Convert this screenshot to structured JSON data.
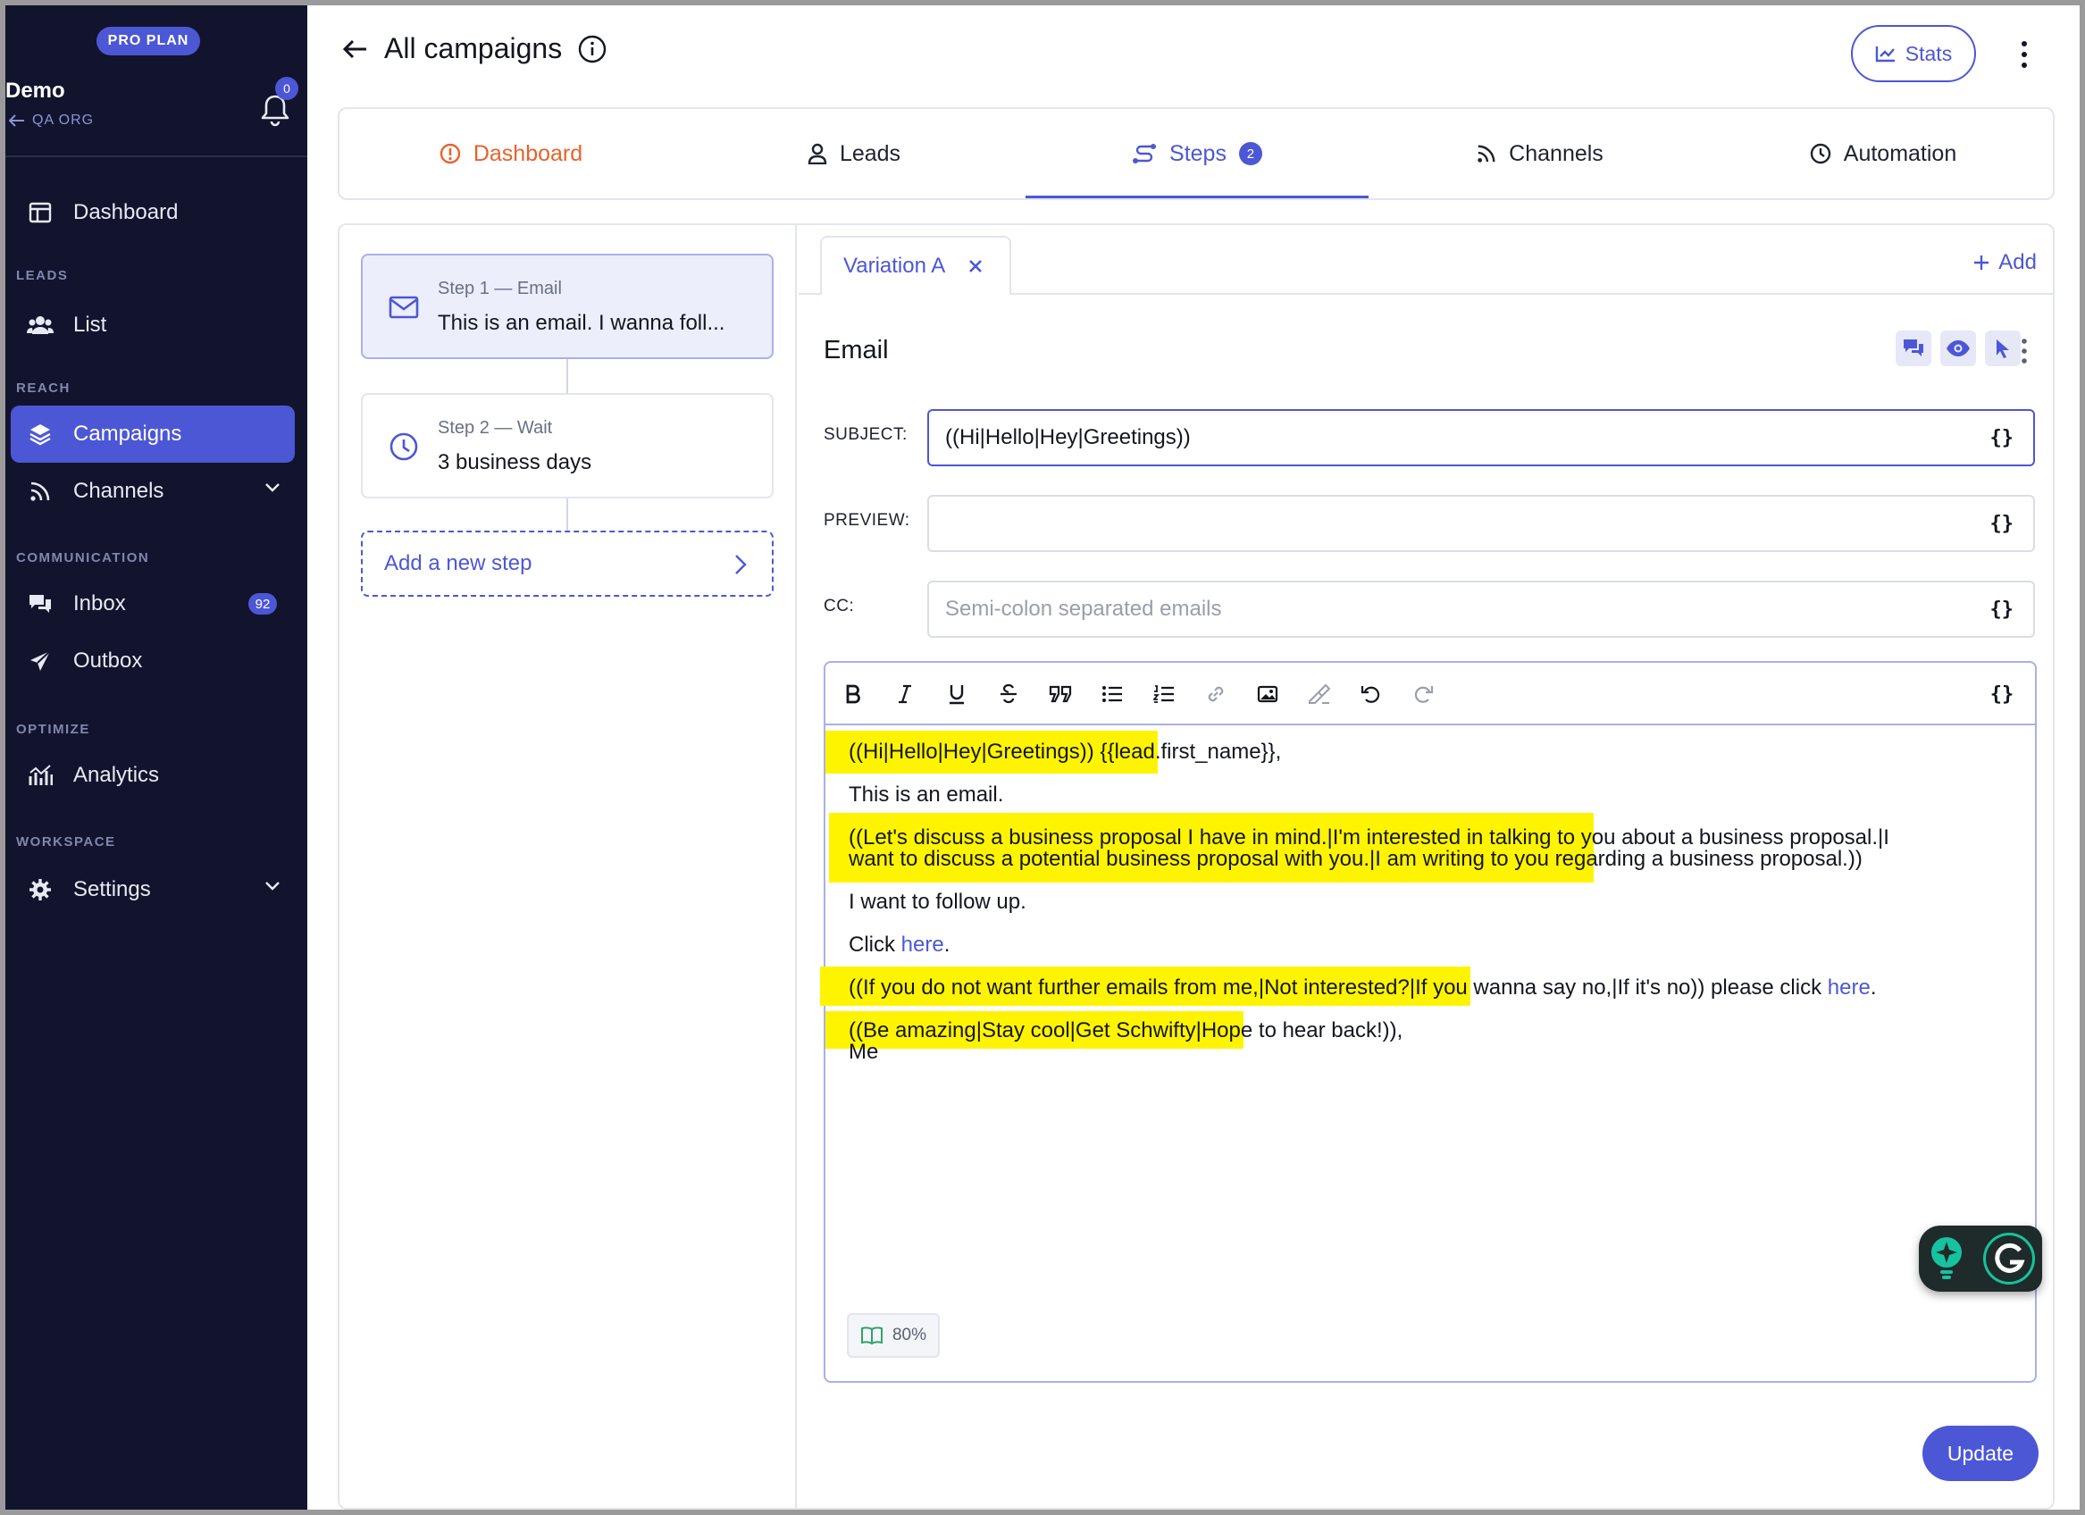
{
  "sidebar": {
    "plan_badge": "PRO PLAN",
    "org_name": "Demo",
    "org_back": "QA ORG",
    "notifications_count": "0",
    "dashboard": "Dashboard",
    "section_leads": "LEADS",
    "list": "List",
    "section_reach": "REACH",
    "campaigns": "Campaigns",
    "channels": "Channels",
    "section_communication": "COMMUNICATION",
    "inbox": "Inbox",
    "inbox_count": "92",
    "outbox": "Outbox",
    "section_optimize": "OPTIMIZE",
    "analytics": "Analytics",
    "section_workspace": "WORKSPACE",
    "settings": "Settings"
  },
  "header": {
    "title": "All campaigns",
    "stats_label": "Stats"
  },
  "tabs": {
    "dashboard": "Dashboard",
    "leads": "Leads",
    "steps": "Steps",
    "steps_count": "2",
    "channels": "Channels",
    "automation": "Automation"
  },
  "steps": {
    "step1_caption": "Step 1 — Email",
    "step1_text": "This is an email. I wanna foll...",
    "step2_caption": "Step 2 — Wait",
    "step2_text": "3 business days",
    "add_step": "Add a new step"
  },
  "editor": {
    "variation_tab": "Variation A",
    "add_label": "Add",
    "section_title": "Email",
    "subject_label": "SUBJECT:",
    "subject_value": "((Hi|Hello|Hey|Greetings))",
    "preview_label": "PREVIEW:",
    "preview_value": "",
    "cc_label": "CC:",
    "cc_placeholder": "Semi-colon separated emails",
    "brace_symbol": "{}",
    "body": {
      "greeting": "((Hi|Hello|Hey|Greetings)) {{lead.first_name}},",
      "line1": "This is an email.",
      "proposal_line1": "((Let's discuss a business proposal I have in mind.|I'm interested in talking to you about a business proposal.|I",
      "proposal_line2": "want to discuss a potential business proposal with you.|I am writing to you regarding a business proposal.))",
      "follow_up": "I want to follow up.",
      "click_prefix": "Click ",
      "click_link": "here",
      "click_suffix": ".",
      "unsub_spin": "((If you do not want further emails from me,|Not interested?|If you wanna say no,|If it's no))",
      "unsub_text": " please click ",
      "unsub_link": "here",
      "unsub_suffix": ".",
      "signoff": "((Be amazing|Stay cool|Get Schwifty|Hope to hear back!)),",
      "signature": "Me"
    },
    "readability": "80%",
    "update_label": "Update"
  },
  "colors": {
    "accent": "#4c57d6",
    "sidebar_bg": "#12142d",
    "highlight": "#fff400",
    "dashboard_tab": "#e8622a"
  }
}
